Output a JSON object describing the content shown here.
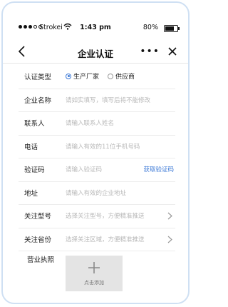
{
  "status_bar": {
    "carrier": "Strokei",
    "time": "1:43 pm",
    "battery": "80%"
  },
  "nav": {
    "title": "企业认证",
    "more": "•••"
  },
  "form": {
    "type": {
      "label": "认证类型",
      "options": [
        "生产厂家",
        "供应商"
      ],
      "selected": "生产厂家"
    },
    "company": {
      "label": "企业名称",
      "placeholder": "请如实填写，填写后将不能修改"
    },
    "contact": {
      "label": "联系人",
      "placeholder": "请输入联系人姓名"
    },
    "phone": {
      "label": "电话",
      "placeholder": "请输入有效的11位手机号码"
    },
    "code": {
      "label": "验证码",
      "placeholder": "请输入验证码",
      "action": "获取验证码"
    },
    "address": {
      "label": "地址",
      "placeholder": "请输入有效的企业地址"
    },
    "model": {
      "label": "关注型号",
      "placeholder": "选择关注型号，方便精准推送"
    },
    "province": {
      "label": "关注省份",
      "placeholder": "选择关注区域，方便精准推送"
    },
    "license": {
      "label": "营业执照",
      "upload_text": "点击添加"
    }
  },
  "colors": {
    "accent": "#3b78d6",
    "placeholder": "#b8b8b8",
    "frame": "#cfe0f3"
  }
}
